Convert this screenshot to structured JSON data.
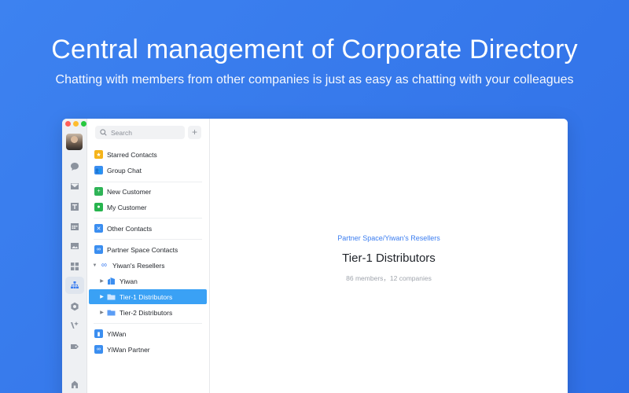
{
  "hero": {
    "title": "Central management of  Corporate  Directory",
    "subtitle": "Chatting with members from other companies is just as easy as chatting with your colleagues"
  },
  "rail": {
    "icons": [
      "chat-icon",
      "mail-icon",
      "docs-icon",
      "calendar-icon",
      "image-icon",
      "apps-icon",
      "org-chart-icon",
      "hexagon-icon",
      "sparkle-icon",
      "tag-icon",
      "home-icon"
    ],
    "active": "org-chart-icon"
  },
  "search": {
    "placeholder": "Search",
    "add_label": "+"
  },
  "contacts": {
    "starred": "Starred Contacts",
    "group_chat": "Group Chat",
    "new_customer": "New Customer",
    "my_customer": "My Customer",
    "other_contacts": "Other Contacts",
    "partner_space": "Partner Space Contacts",
    "resellers": "Yiwan's Resellers",
    "yiwan": "Yiwan",
    "tier1": "Tier-1 Distributors",
    "tier2": "Tier-2 Distributors",
    "yiwan_org": "YiWan",
    "yiwan_partner": "YiWan Partner"
  },
  "detail": {
    "breadcrumb": "Partner Space/Yiwan's Resellers",
    "title": "Tier-1 Distributors",
    "meta": "86 members，12 companies"
  },
  "colors": {
    "background": "#3478ec",
    "accent": "#3b7df0",
    "selected": "#3aa1f5"
  }
}
